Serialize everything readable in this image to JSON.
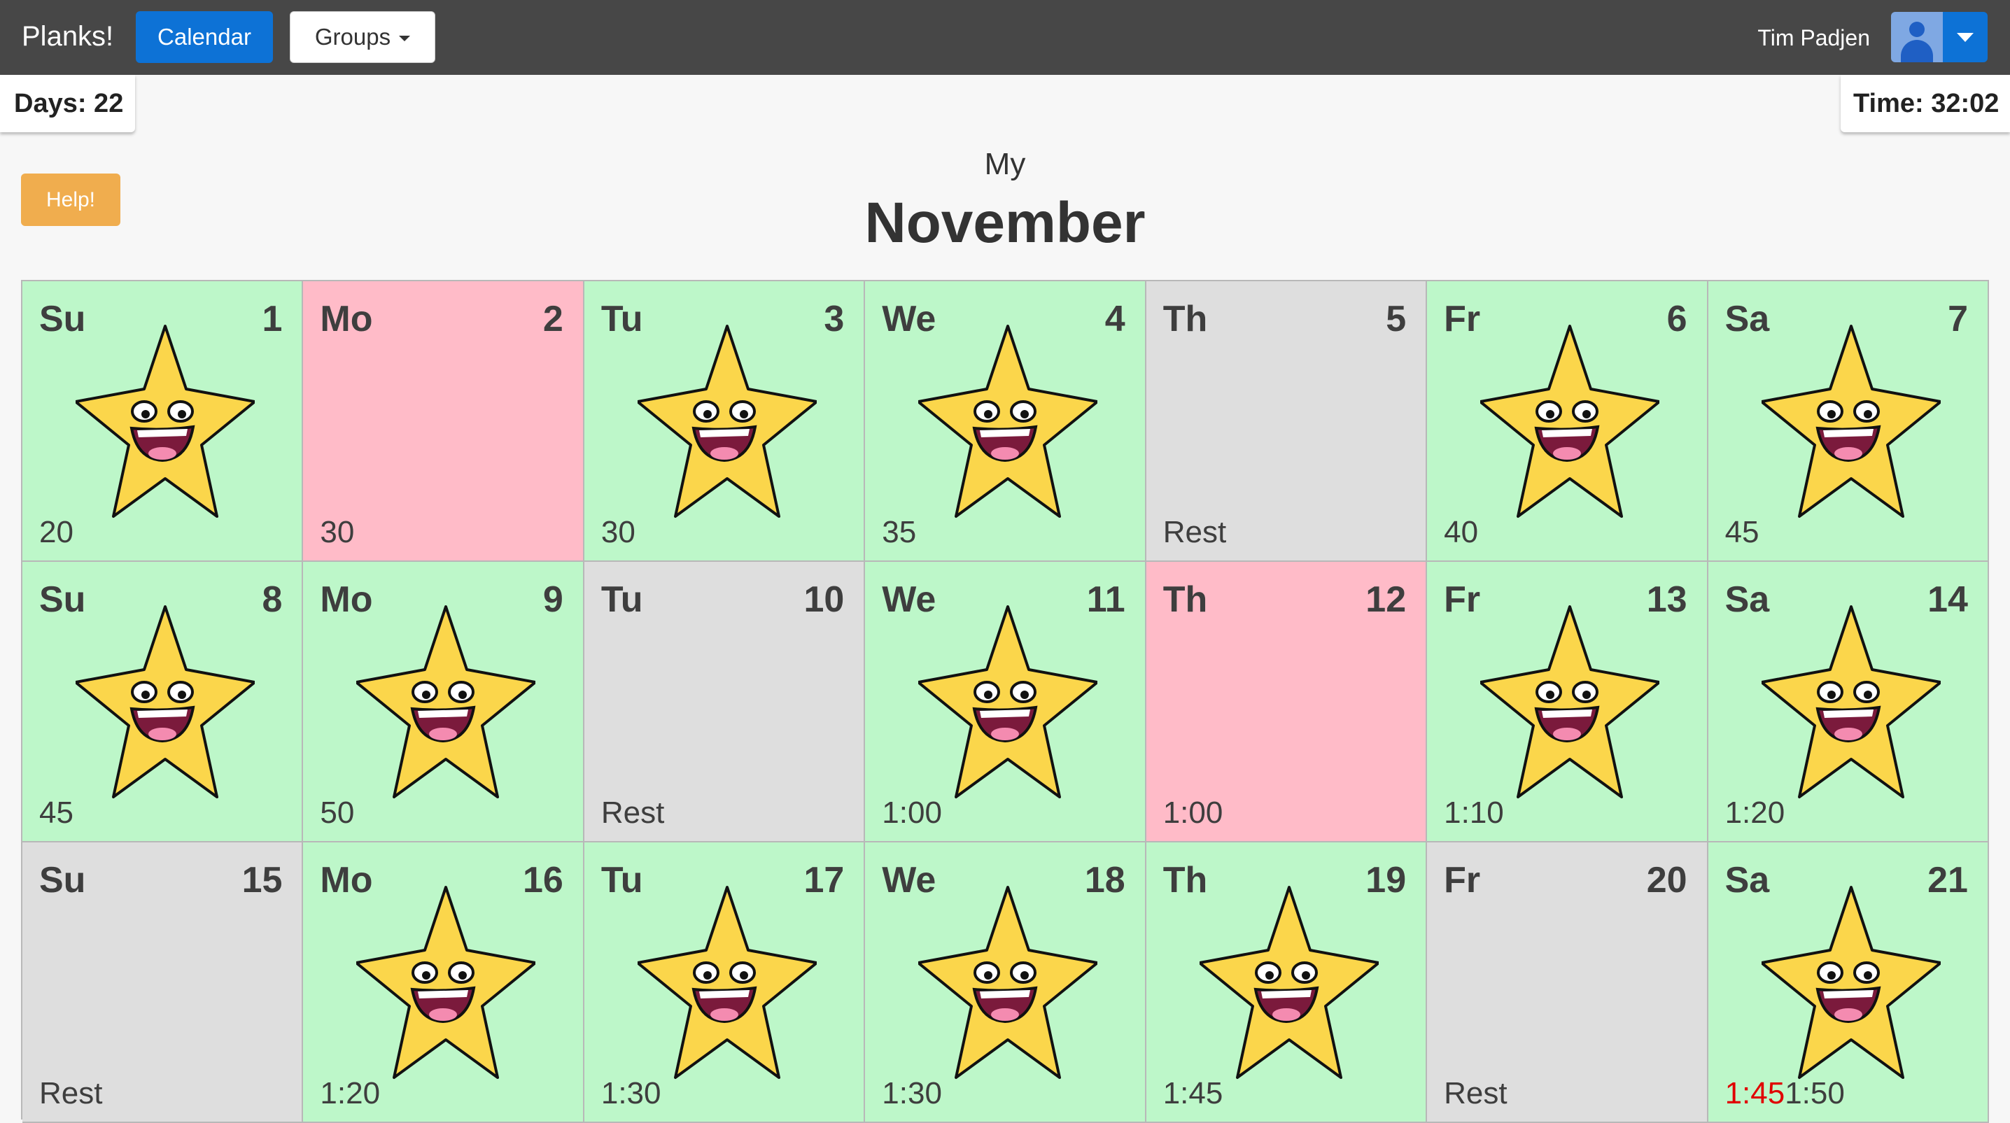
{
  "navbar": {
    "brand": "Planks!",
    "calendar_label": "Calendar",
    "groups_label": "Groups",
    "username": "Tim Padjen"
  },
  "stats": {
    "days": "Days: 22",
    "time": "Time: 32:02"
  },
  "help_label": "Help!",
  "title": {
    "prefix": "My",
    "month": "November"
  },
  "colors": {
    "done": "#bdf7c9",
    "missed": "#ffbbc8",
    "rest": "#dedede",
    "late": "#e00000"
  },
  "days": [
    {
      "name": "Su",
      "num": "1",
      "status": "done",
      "target": "20"
    },
    {
      "name": "Mo",
      "num": "2",
      "status": "missed",
      "target": "30"
    },
    {
      "name": "Tu",
      "num": "3",
      "status": "done",
      "target": "30"
    },
    {
      "name": "We",
      "num": "4",
      "status": "done",
      "target": "35"
    },
    {
      "name": "Th",
      "num": "5",
      "status": "rest",
      "target": "Rest"
    },
    {
      "name": "Fr",
      "num": "6",
      "status": "done",
      "target": "40"
    },
    {
      "name": "Sa",
      "num": "7",
      "status": "done",
      "target": "45"
    },
    {
      "name": "Su",
      "num": "8",
      "status": "done",
      "target": "45"
    },
    {
      "name": "Mo",
      "num": "9",
      "status": "done",
      "target": "50"
    },
    {
      "name": "Tu",
      "num": "10",
      "status": "rest",
      "target": "Rest"
    },
    {
      "name": "We",
      "num": "11",
      "status": "done",
      "target": "1:00"
    },
    {
      "name": "Th",
      "num": "12",
      "status": "missed",
      "target": "1:00"
    },
    {
      "name": "Fr",
      "num": "13",
      "status": "done",
      "target": "1:10"
    },
    {
      "name": "Sa",
      "num": "14",
      "status": "done",
      "target": "1:20"
    },
    {
      "name": "Su",
      "num": "15",
      "status": "rest",
      "target": "Rest"
    },
    {
      "name": "Mo",
      "num": "16",
      "status": "done",
      "target": "1:20"
    },
    {
      "name": "Tu",
      "num": "17",
      "status": "done",
      "target": "1:30"
    },
    {
      "name": "We",
      "num": "18",
      "status": "done",
      "target": "1:30"
    },
    {
      "name": "Th",
      "num": "19",
      "status": "done",
      "target": "1:45"
    },
    {
      "name": "Fr",
      "num": "20",
      "status": "rest",
      "target": "Rest"
    },
    {
      "name": "Sa",
      "num": "21",
      "status": "done",
      "target": "1:50",
      "late": "1:45"
    }
  ]
}
